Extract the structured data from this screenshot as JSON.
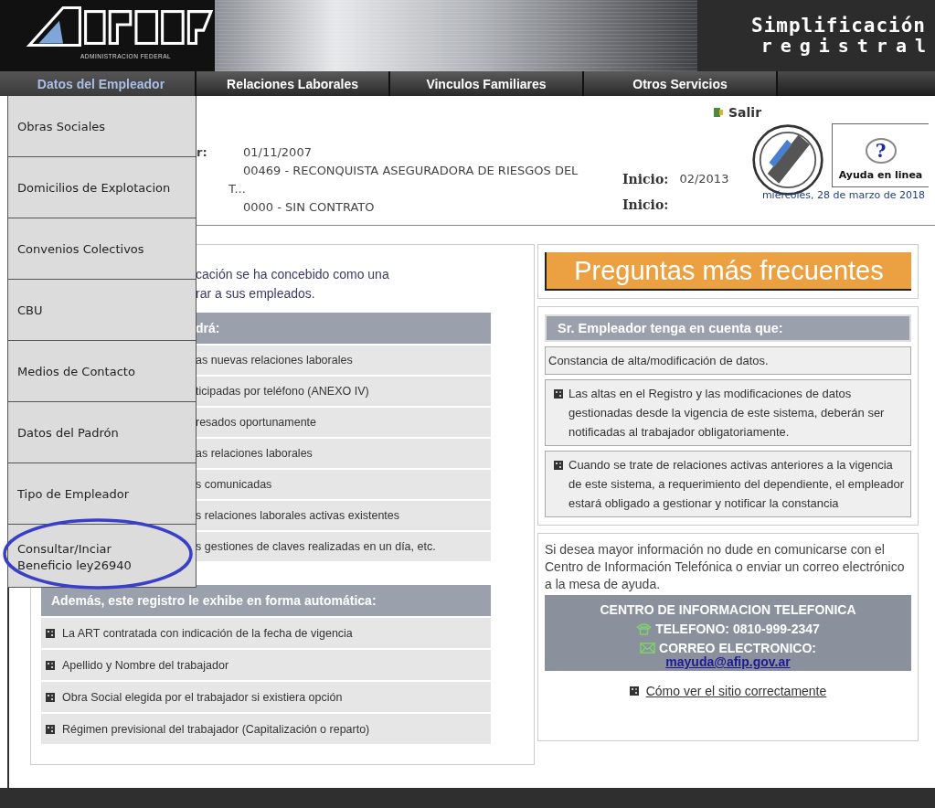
{
  "header": {
    "logo_caption": "ADMINISTRACION FEDERAL",
    "title": "Simplificación",
    "subtitle": "registral"
  },
  "nav": [
    {
      "label": "Datos del Empleador",
      "selected": true
    },
    {
      "label": "Relaciones Laborales",
      "selected": false
    },
    {
      "label": "Vinculos Familiares",
      "selected": false
    },
    {
      "label": "Otros Servicios",
      "selected": false
    }
  ],
  "menu": [
    {
      "label": "Obras Sociales",
      "circled": false
    },
    {
      "label": "Domicilios de Explotacion",
      "circled": false
    },
    {
      "label": "Convenios Colectivos",
      "circled": false
    },
    {
      "label": "CBU",
      "circled": false
    },
    {
      "label": "Medios de Contacto",
      "circled": false
    },
    {
      "label": "Datos del Padrón",
      "circled": false
    },
    {
      "label": "Tipo de Empleador",
      "circled": false
    },
    {
      "label": "Consultar/Inciar Beneficio ley26940",
      "circled": true
    }
  ],
  "logout": "Salir",
  "info": {
    "label_fragment": "r:",
    "values": [
      "01/11/2007",
      "00469 - RECONQUISTA ASEGURADORA DE RIESGOS DEL T...",
      "0000 - SIN CONTRATO"
    ],
    "starts": [
      {
        "label": "Inicio:",
        "value": "02/2013"
      },
      {
        "label": "Inicio:"
      }
    ],
    "help_glyph": "?",
    "help_button": "Ayuda en linea",
    "date": "miércoles, 28 de marzo de 2018"
  },
  "left": {
    "intro": [
      "cación se ha concebido como una",
      "rar a sus empleados."
    ],
    "list_heading": "drá:",
    "list": [
      "as nuevas relaciones laborales",
      "ticipadas por teléfono (ANEXO IV)",
      "resados oportunamente",
      "as relaciones laborales",
      "s comunicadas",
      "s relaciones laborales activas existentes",
      "s gestiones de claves realizadas en un día, etc."
    ],
    "auto_heading": "Además, este registro le exhibe en forma automática:",
    "auto_list": [
      "La ART contratada con indicación de la fecha de vigencia",
      "Apellido y Nombre del trabajador",
      "Obra Social elegida por el trabajador si existiera opción",
      "Régimen previsional del trabajador (Capitalización o reparto)"
    ]
  },
  "right": {
    "faq_button": "Preguntas más frecuentes",
    "notes_heading": "Sr. Empleador tenga en cuenta que:",
    "notes": [
      {
        "kind": "plain",
        "text": "Constancia de alta/modificación de datos."
      },
      {
        "kind": "bullet",
        "text": "Las altas en el Registro y las modificaciones de datos gestionadas desde la vigencia de este sistema, deberán ser notificadas al trabajador obligatoriamente."
      },
      {
        "kind": "bullet",
        "text": "Cuando se trate de relaciones activas anteriores a la vigencia de este sistema, a requerimiento del dependiente, el empleador estará obligado a gestionar y notificar la constancia"
      }
    ],
    "contact_intro": "Si desea mayor información no dude en comunicarse con el Centro de Información Telefónica o enviar un correo electrónico a la mesa de ayuda.",
    "contact_heading": "CENTRO DE INFORMACION TELEFONICA",
    "phone": "TELEFONO: 0810-999-2347",
    "email_label": "CORREO ELECTRONICO:",
    "email": "mayuda@afip.gov.ar",
    "site_link": "Cómo ver el sitio correctamente"
  }
}
